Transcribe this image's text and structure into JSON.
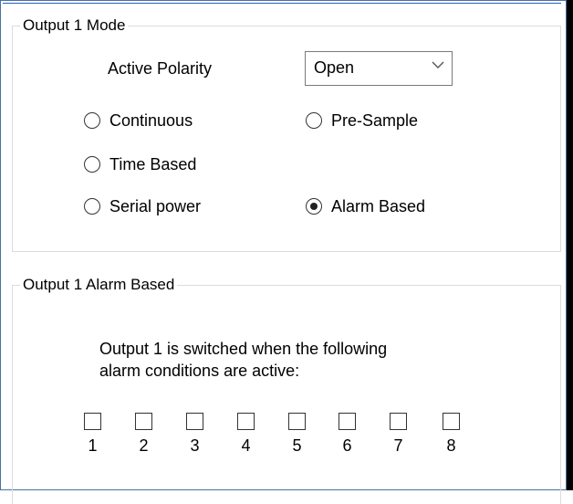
{
  "mode_group": {
    "title": "Output 1 Mode",
    "polarity_label": "Active Polarity",
    "polarity_select": {
      "selected": "Open"
    },
    "options": [
      {
        "label": "Continuous",
        "checked": false
      },
      {
        "label": "Pre-Sample",
        "checked": false
      },
      {
        "label": "Time Based",
        "checked": false
      },
      {
        "label": "Serial power",
        "checked": false
      },
      {
        "label": "Alarm Based",
        "checked": true
      }
    ]
  },
  "alarm_group": {
    "title": "Output 1 Alarm Based",
    "description_line1": "Output 1 is switched when the following",
    "description_line2": "alarm conditions are active:",
    "alarms": [
      {
        "label": "1",
        "checked": false
      },
      {
        "label": "2",
        "checked": false
      },
      {
        "label": "3",
        "checked": false
      },
      {
        "label": "4",
        "checked": false
      },
      {
        "label": "5",
        "checked": false
      },
      {
        "label": "6",
        "checked": false
      },
      {
        "label": "7",
        "checked": false
      },
      {
        "label": "8",
        "checked": false
      }
    ]
  },
  "icons": {
    "dropdown": "chevron-down-icon"
  },
  "colors": {
    "frame_border": "#4a6fa5",
    "group_border": "#dcdcdc",
    "right_bar": "#000000"
  }
}
